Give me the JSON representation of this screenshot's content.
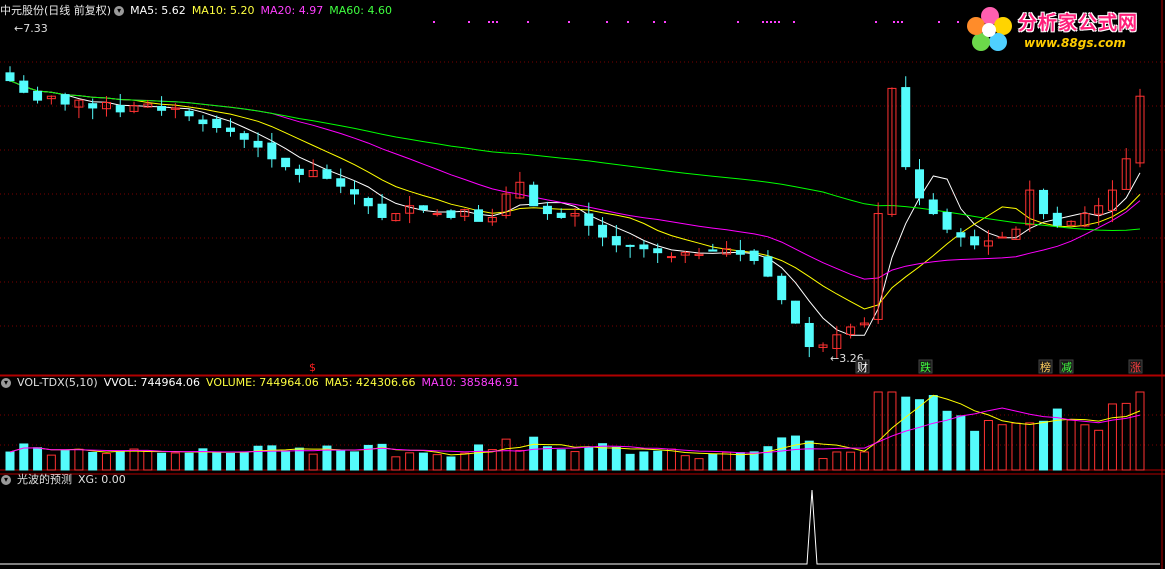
{
  "main_panel": {
    "header": {
      "stock_label": "中元股份(日线 前复权)",
      "ma5_label": "MA5: 5.62",
      "ma10_label": "MA10: 5.20",
      "ma20_label": "MA20: 4.97",
      "ma60_label": "MA60: 4.60"
    },
    "high_marker": "7.33",
    "low_marker": "3.26",
    "event_labels": [
      {
        "text": "$",
        "color": "#ff2020"
      },
      {
        "text": "财",
        "color": "#ffffff"
      },
      {
        "text": "跌",
        "color": "#40ff40"
      },
      {
        "text": "榜",
        "color": "#ffd060"
      },
      {
        "text": "减",
        "color": "#40ff40"
      },
      {
        "text": "涨",
        "color": "#ff4040"
      }
    ]
  },
  "volume_panel": {
    "header": {
      "name_label": "VOL-TDX(5,10)",
      "vvol_label": "VVOL: 744964.06",
      "volume_label": "VOLUME: 744964.06",
      "ma5_label": "MA5: 424306.66",
      "ma10_label": "MA10: 385846.91"
    }
  },
  "indicator_panel": {
    "header": {
      "name_label": "光波的预测",
      "xg_label": "XG: 0.00"
    }
  },
  "logo": {
    "title": "分析家公式网",
    "url": "www.88gs.com"
  },
  "colors": {
    "up_candle": "#ff3232",
    "down_candle": "#54fcfc",
    "ma5": "#ffffff",
    "ma10": "#ffff00",
    "ma20": "#ff00ff",
    "ma60": "#00ff00",
    "grid": "#7a0000"
  },
  "chart_data": {
    "type": "candlestick",
    "title": "中元股份(日线 前复权)",
    "xlabel": "",
    "ylabel": "",
    "ylim": [
      3.0,
      7.5
    ],
    "grid": true,
    "price_extremes": {
      "high": 7.33,
      "low": 3.26
    },
    "closes": [
      6.7,
      6.55,
      6.45,
      6.5,
      6.4,
      6.45,
      6.35,
      6.42,
      6.3,
      6.38,
      6.4,
      6.32,
      6.35,
      6.25,
      6.15,
      6.1,
      6.05,
      5.95,
      5.85,
      5.7,
      5.6,
      5.5,
      5.55,
      5.45,
      5.35,
      5.25,
      5.1,
      4.95,
      5.0,
      5.1,
      5.05,
      5.0,
      4.95,
      5.05,
      4.9,
      4.95,
      5.25,
      5.4,
      5.1,
      5.0,
      4.95,
      5.0,
      4.85,
      4.7,
      4.6,
      4.58,
      4.55,
      4.5,
      4.45,
      4.5,
      4.48,
      4.52,
      4.55,
      4.48,
      4.4,
      4.2,
      3.9,
      3.6,
      3.3,
      3.32,
      3.45,
      3.55,
      3.6,
      5.0,
      6.6,
      5.6,
      5.2,
      5.0,
      4.8,
      4.7,
      4.6,
      4.65,
      4.7,
      4.8,
      5.3,
      5.0,
      4.85,
      4.9,
      5.0,
      5.1,
      5.3,
      5.7,
      6.5
    ],
    "series": [
      {
        "name": "MA5",
        "value": 5.62
      },
      {
        "name": "MA10",
        "value": 5.2
      },
      {
        "name": "MA20",
        "value": 4.97
      },
      {
        "name": "MA60",
        "value": 4.6
      }
    ],
    "volume": {
      "vvol": 744964.06,
      "volume": 744964.06,
      "ma5": 424306.66,
      "ma10": 385846.91
    },
    "xg": 0.0
  }
}
